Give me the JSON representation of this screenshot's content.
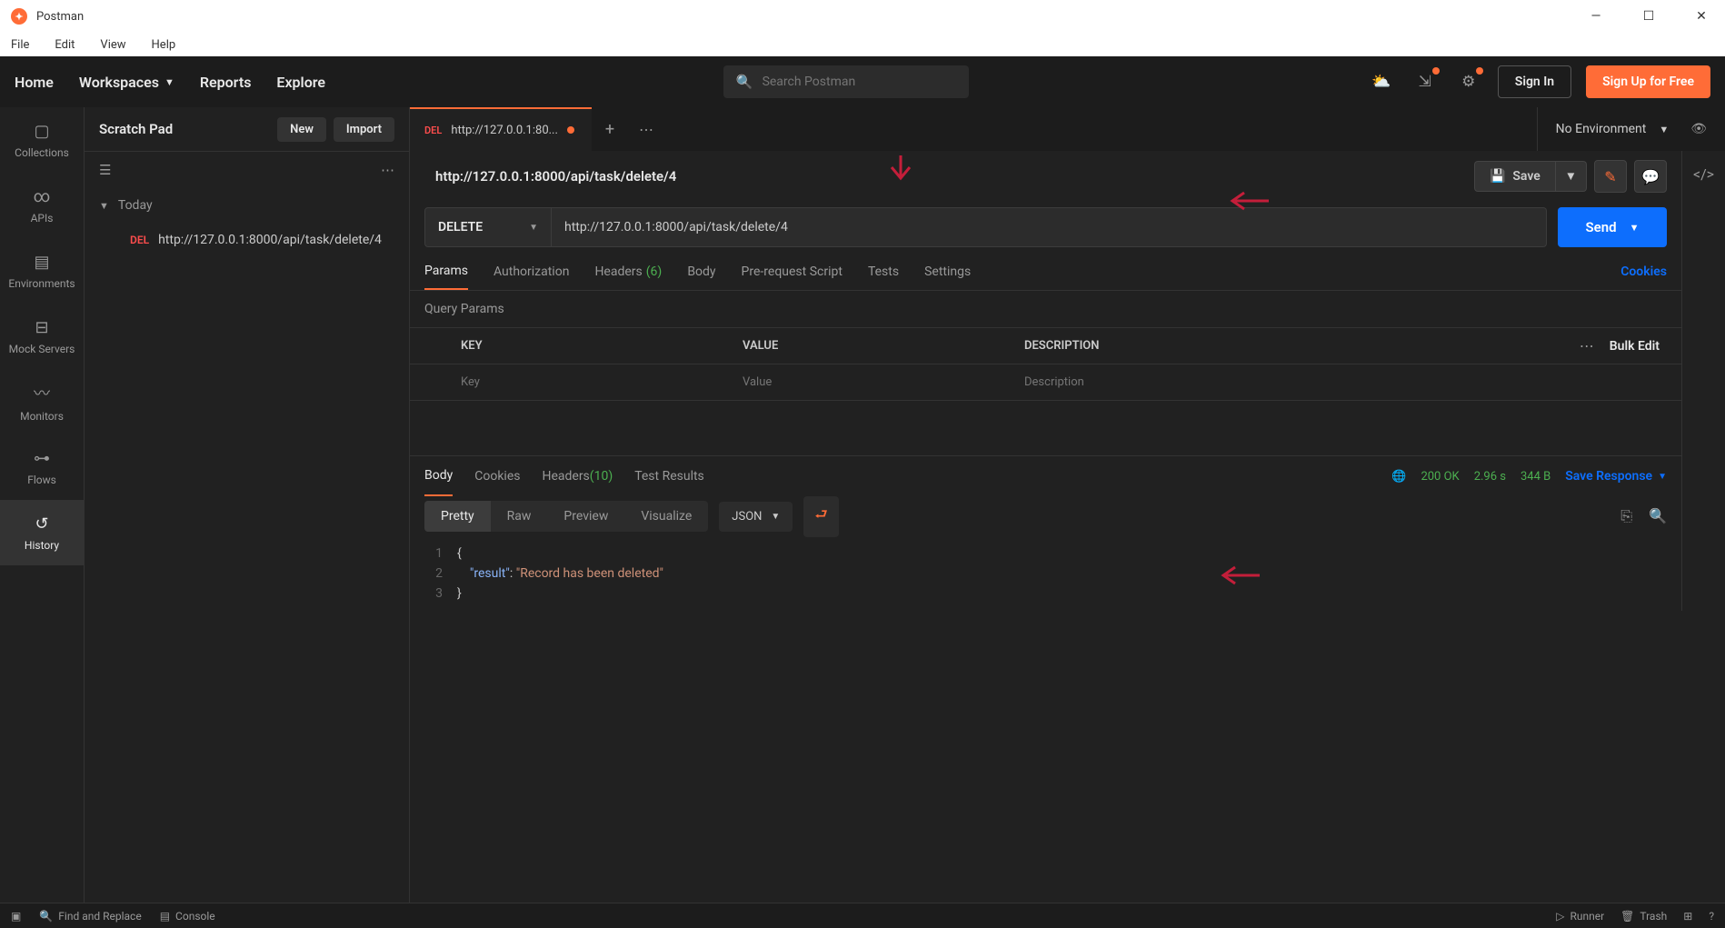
{
  "app": {
    "title": "Postman"
  },
  "menubar": [
    "File",
    "Edit",
    "View",
    "Help"
  ],
  "topbar": {
    "items": [
      "Home",
      "Workspaces",
      "Reports",
      "Explore"
    ],
    "search_placeholder": "Search Postman",
    "signin": "Sign In",
    "signup": "Sign Up for Free"
  },
  "sidebar": {
    "items": [
      {
        "icon": "folder",
        "label": "Collections"
      },
      {
        "icon": "api",
        "label": "APIs"
      },
      {
        "icon": "env",
        "label": "Environments"
      },
      {
        "icon": "mock",
        "label": "Mock Servers"
      },
      {
        "icon": "monitor",
        "label": "Monitors"
      },
      {
        "icon": "flow",
        "label": "Flows"
      },
      {
        "icon": "history",
        "label": "History"
      }
    ]
  },
  "panel": {
    "title": "Scratch Pad",
    "new_btn": "New",
    "import_btn": "Import",
    "today": "Today",
    "history_method": "DEL",
    "history_url": "http://127.0.0.1:8000/api/task/delete/4"
  },
  "tabs": {
    "tab_method": "DEL",
    "tab_label": "http://127.0.0.1:80...",
    "env": "No Environment"
  },
  "request": {
    "title": "http://127.0.0.1:8000/api/task/delete/4",
    "save": "Save",
    "method": "DELETE",
    "url": "http://127.0.0.1:8000/api/task/delete/4",
    "send": "Send",
    "tabs": {
      "params": "Params",
      "auth": "Authorization",
      "headers": "Headers",
      "headers_count": "(6)",
      "body": "Body",
      "prereq": "Pre-request Script",
      "tests": "Tests",
      "settings": "Settings"
    },
    "cookies": "Cookies",
    "query_params": "Query Params",
    "cols": {
      "key": "KEY",
      "value": "VALUE",
      "desc": "DESCRIPTION"
    },
    "bulk_edit": "Bulk Edit",
    "placeholders": {
      "key": "Key",
      "value": "Value",
      "desc": "Description"
    }
  },
  "response": {
    "tabs": {
      "body": "Body",
      "cookies": "Cookies",
      "headers": "Headers",
      "headers_count": "(10)",
      "test_results": "Test Results"
    },
    "status_code": "200 OK",
    "time": "2.96 s",
    "size": "344 B",
    "save_response": "Save Response",
    "views": {
      "pretty": "Pretty",
      "raw": "Raw",
      "preview": "Preview",
      "visualize": "Visualize"
    },
    "format": "JSON",
    "json_key": "\"result\"",
    "json_value": "\"Record has been deleted\""
  },
  "statusbar": {
    "find": "Find and Replace",
    "console": "Console",
    "runner": "Runner",
    "trash": "Trash"
  }
}
